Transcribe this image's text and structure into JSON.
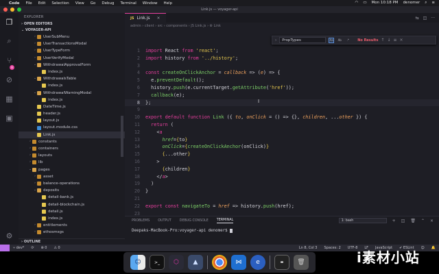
{
  "menubar": {
    "app": "Code",
    "items": [
      "File",
      "Edit",
      "Selection",
      "View",
      "Go",
      "Debug",
      "Terminal",
      "Window",
      "Help"
    ],
    "clock": "Mon 10:18 PM",
    "user": "denomer"
  },
  "window": {
    "title": "Link.js — voyager-api"
  },
  "sidebar": {
    "title": "EXPLORER",
    "open_editors": "OPEN EDITORS",
    "project": "VOYAGER-API",
    "outline": "OUTLINE",
    "tree": [
      {
        "label": "UserSubMenu",
        "indent": 3,
        "type": "folder",
        "open": false
      },
      {
        "label": "UserTransactionsModal",
        "indent": 3,
        "type": "folder",
        "open": false
      },
      {
        "label": "UserTypeForm",
        "indent": 3,
        "type": "folder",
        "open": false
      },
      {
        "label": "UserVerifyModal",
        "indent": 3,
        "type": "folder",
        "open": false
      },
      {
        "label": "WithdrawalApprovalForm",
        "indent": 3,
        "type": "folder",
        "open": true
      },
      {
        "label": "index.js",
        "indent": 4,
        "type": "js"
      },
      {
        "label": "WithdrawalsTable",
        "indent": 3,
        "type": "folder",
        "open": true
      },
      {
        "label": "index.js",
        "indent": 4,
        "type": "js"
      },
      {
        "label": "WithdrawalWarningModal",
        "indent": 3,
        "type": "folder",
        "open": true
      },
      {
        "label": "index.js",
        "indent": 4,
        "type": "js"
      },
      {
        "label": "DateTime.js",
        "indent": 3,
        "type": "js"
      },
      {
        "label": "header.js",
        "indent": 3,
        "type": "js"
      },
      {
        "label": "layout.js",
        "indent": 3,
        "type": "js"
      },
      {
        "label": "layout.module.css",
        "indent": 3,
        "type": "css"
      },
      {
        "label": "Link.js",
        "indent": 3,
        "type": "js",
        "selected": true
      },
      {
        "label": "constants",
        "indent": 2,
        "type": "folder",
        "open": false
      },
      {
        "label": "containers",
        "indent": 2,
        "type": "folder",
        "open": false
      },
      {
        "label": "layouts",
        "indent": 2,
        "type": "folder",
        "open": false
      },
      {
        "label": "lib",
        "indent": 2,
        "type": "folder",
        "open": false
      },
      {
        "label": "pages",
        "indent": 2,
        "type": "folder",
        "open": true
      },
      {
        "label": "asset",
        "indent": 3,
        "type": "folder",
        "open": false
      },
      {
        "label": "balance-operations",
        "indent": 3,
        "type": "folder",
        "open": false
      },
      {
        "label": "deposits",
        "indent": 3,
        "type": "folder",
        "open": true
      },
      {
        "label": "detail-bank.js",
        "indent": 4,
        "type": "js"
      },
      {
        "label": "detail-blockchain.js",
        "indent": 4,
        "type": "js"
      },
      {
        "label": "detail.js",
        "indent": 4,
        "type": "js"
      },
      {
        "label": "index.js",
        "indent": 4,
        "type": "js"
      },
      {
        "label": "entitlements",
        "indent": 3,
        "type": "folder",
        "open": false
      },
      {
        "label": "ethosmsgs",
        "indent": 3,
        "type": "folder",
        "open": false
      }
    ]
  },
  "editor": {
    "tab": {
      "icon": "JS",
      "label": "Link.js"
    },
    "breadcrumbs": "admin › client › src › components › JS Link.js › ⚙ Link",
    "find": {
      "value": "PropTypes",
      "opt_case": "Aa",
      "opt_word": "Ab",
      "opt_regex": ".*",
      "result": "No Results"
    }
  },
  "code": [
    {
      "n": "1",
      "t": [
        [
          "kw",
          "import"
        ],
        [
          "ct",
          " React "
        ],
        [
          "kw",
          "from"
        ],
        [
          "str",
          " 'react'"
        ],
        [
          "ct",
          ";"
        ]
      ]
    },
    {
      "n": "2",
      "t": [
        [
          "kw",
          "import"
        ],
        [
          "ct",
          " history "
        ],
        [
          "kw",
          "from"
        ],
        [
          "str",
          " '../history'"
        ],
        [
          "ct",
          ";"
        ]
      ]
    },
    {
      "n": "3",
      "t": []
    },
    {
      "n": "4",
      "t": [
        [
          "kw",
          "const"
        ],
        [
          "fn",
          " createOnClickAnchor"
        ],
        [
          "op",
          " = "
        ],
        [
          "prm",
          "callback"
        ],
        [
          "op",
          " => ("
        ],
        [
          "prm",
          "e"
        ],
        [
          "op",
          ") => {"
        ]
      ]
    },
    {
      "n": "5",
      "t": [
        [
          "ct",
          "  e."
        ],
        [
          "fn",
          "preventDefault"
        ],
        [
          "ct",
          "();"
        ]
      ]
    },
    {
      "n": "6",
      "t": [
        [
          "ct",
          "  history."
        ],
        [
          "fn",
          "push"
        ],
        [
          "ct",
          "(e.currentTarget."
        ],
        [
          "fn",
          "getAttribute"
        ],
        [
          "ct",
          "("
        ],
        [
          "str",
          "'href'"
        ],
        [
          "ct",
          "));"
        ]
      ]
    },
    {
      "n": "7",
      "t": [
        [
          "fn",
          "  callback"
        ],
        [
          "ct",
          "(e);"
        ]
      ]
    },
    {
      "n": "8",
      "t": [
        [
          "op",
          "};"
        ]
      ],
      "cur": true
    },
    {
      "n": "9",
      "t": []
    },
    {
      "n": "10",
      "t": [
        [
          "kw",
          "export default function"
        ],
        [
          "fn",
          " Link"
        ],
        [
          "ct",
          " ({ "
        ],
        [
          "prm",
          "to"
        ],
        [
          "ct",
          ", "
        ],
        [
          "prm",
          "onClick"
        ],
        [
          "op",
          " = () => {}"
        ],
        [
          "ct",
          ", "
        ],
        [
          "prm",
          "children"
        ],
        [
          "ct",
          ", ..."
        ],
        [
          "prm",
          "other"
        ],
        [
          "ct",
          " }) {"
        ]
      ]
    },
    {
      "n": "11",
      "t": [
        [
          "kw",
          "  return"
        ],
        [
          "ct",
          " ("
        ]
      ]
    },
    {
      "n": "12",
      "t": [
        [
          "tag",
          "    <"
        ],
        [
          "kw",
          "a"
        ]
      ]
    },
    {
      "n": "13",
      "t": [
        [
          "attr",
          "      href"
        ],
        [
          "op",
          "="
        ],
        [
          "brk",
          "{"
        ],
        [
          "ct",
          "to"
        ],
        [
          "brk",
          "}"
        ]
      ]
    },
    {
      "n": "14",
      "t": [
        [
          "attr",
          "      onClick"
        ],
        [
          "op",
          "="
        ],
        [
          "brk",
          "{"
        ],
        [
          "fn",
          "createOnClickAnchor"
        ],
        [
          "ct",
          "(onClick)"
        ],
        [
          "brk",
          "}"
        ]
      ]
    },
    {
      "n": "15",
      "t": [
        [
          "brk",
          "      {"
        ],
        [
          "ct",
          "...other"
        ],
        [
          "brk",
          "}"
        ]
      ]
    },
    {
      "n": "16",
      "t": [
        [
          "tag",
          "    >"
        ]
      ]
    },
    {
      "n": "17",
      "t": [
        [
          "brk",
          "      {"
        ],
        [
          "ct",
          "children"
        ],
        [
          "brk",
          "}"
        ]
      ]
    },
    {
      "n": "18",
      "t": [
        [
          "tag",
          "    </"
        ],
        [
          "kw",
          "a"
        ],
        [
          "tag",
          ">"
        ]
      ]
    },
    {
      "n": "19",
      "t": [
        [
          "ct",
          "  )"
        ]
      ]
    },
    {
      "n": "20",
      "t": [
        [
          "ct",
          "}"
        ]
      ]
    },
    {
      "n": "21",
      "t": []
    },
    {
      "n": "22",
      "t": [
        [
          "kw",
          "export const"
        ],
        [
          "fn",
          " navigateTo"
        ],
        [
          "op",
          " = "
        ],
        [
          "prm",
          "href"
        ],
        [
          "op",
          " => "
        ],
        [
          "ct",
          "history."
        ],
        [
          "fn",
          "push"
        ],
        [
          "ct",
          "(href);"
        ]
      ]
    },
    {
      "n": "23",
      "t": []
    }
  ],
  "panel": {
    "tabs": [
      "PROBLEMS",
      "OUTPUT",
      "DEBUG CONSOLE",
      "TERMINAL"
    ],
    "active": "TERMINAL",
    "terminal_select": "1: bash",
    "prompt": "Deepaks-MacBook-Pro:voyager-api denomer$ "
  },
  "status": {
    "branch": "dev*",
    "sync": "⟳",
    "errors": "⊗ 0",
    "warnings": "⚠ 0",
    "position": "Ln 8, Col 3",
    "spaces": "Spaces: 2",
    "encoding": "UTF-8",
    "eol": "LF",
    "language": "JavaScript",
    "eslint": "ESLint"
  },
  "dock": [
    "finder",
    "terminal",
    "graphql",
    "rocket",
    "chrome",
    "vscode",
    "edge",
    "screen",
    "trash"
  ],
  "watermark": "i素材小站",
  "colors": {
    "accent": "#e93f9f",
    "keyword": "#e93f9f",
    "string": "#e6c84f",
    "function": "#7fd36a",
    "param": "#f0a35e",
    "remote": "#b86ee8"
  }
}
